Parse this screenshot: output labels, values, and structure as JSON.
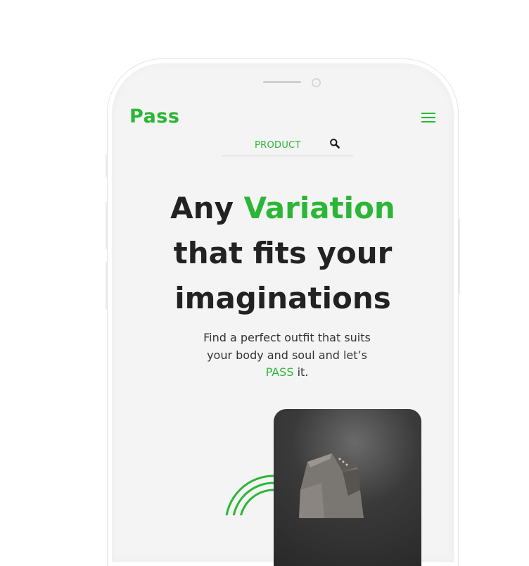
{
  "header": {
    "logo": "Pass"
  },
  "search": {
    "value": "PRODUCT"
  },
  "hero": {
    "line1_a": "Any",
    "line1_b": "Variation",
    "line2": "that fits your",
    "line3": "imaginations",
    "sub_line1": "Find a perfect outfit that suits",
    "sub_line2": "your body and soul and let’s",
    "sub_highlight": "PASS",
    "sub_end": "it."
  },
  "icons": {
    "menu": "hamburger-menu-icon",
    "search": "search-icon"
  },
  "colors": {
    "accent": "#2bb636",
    "text": "#222222"
  }
}
